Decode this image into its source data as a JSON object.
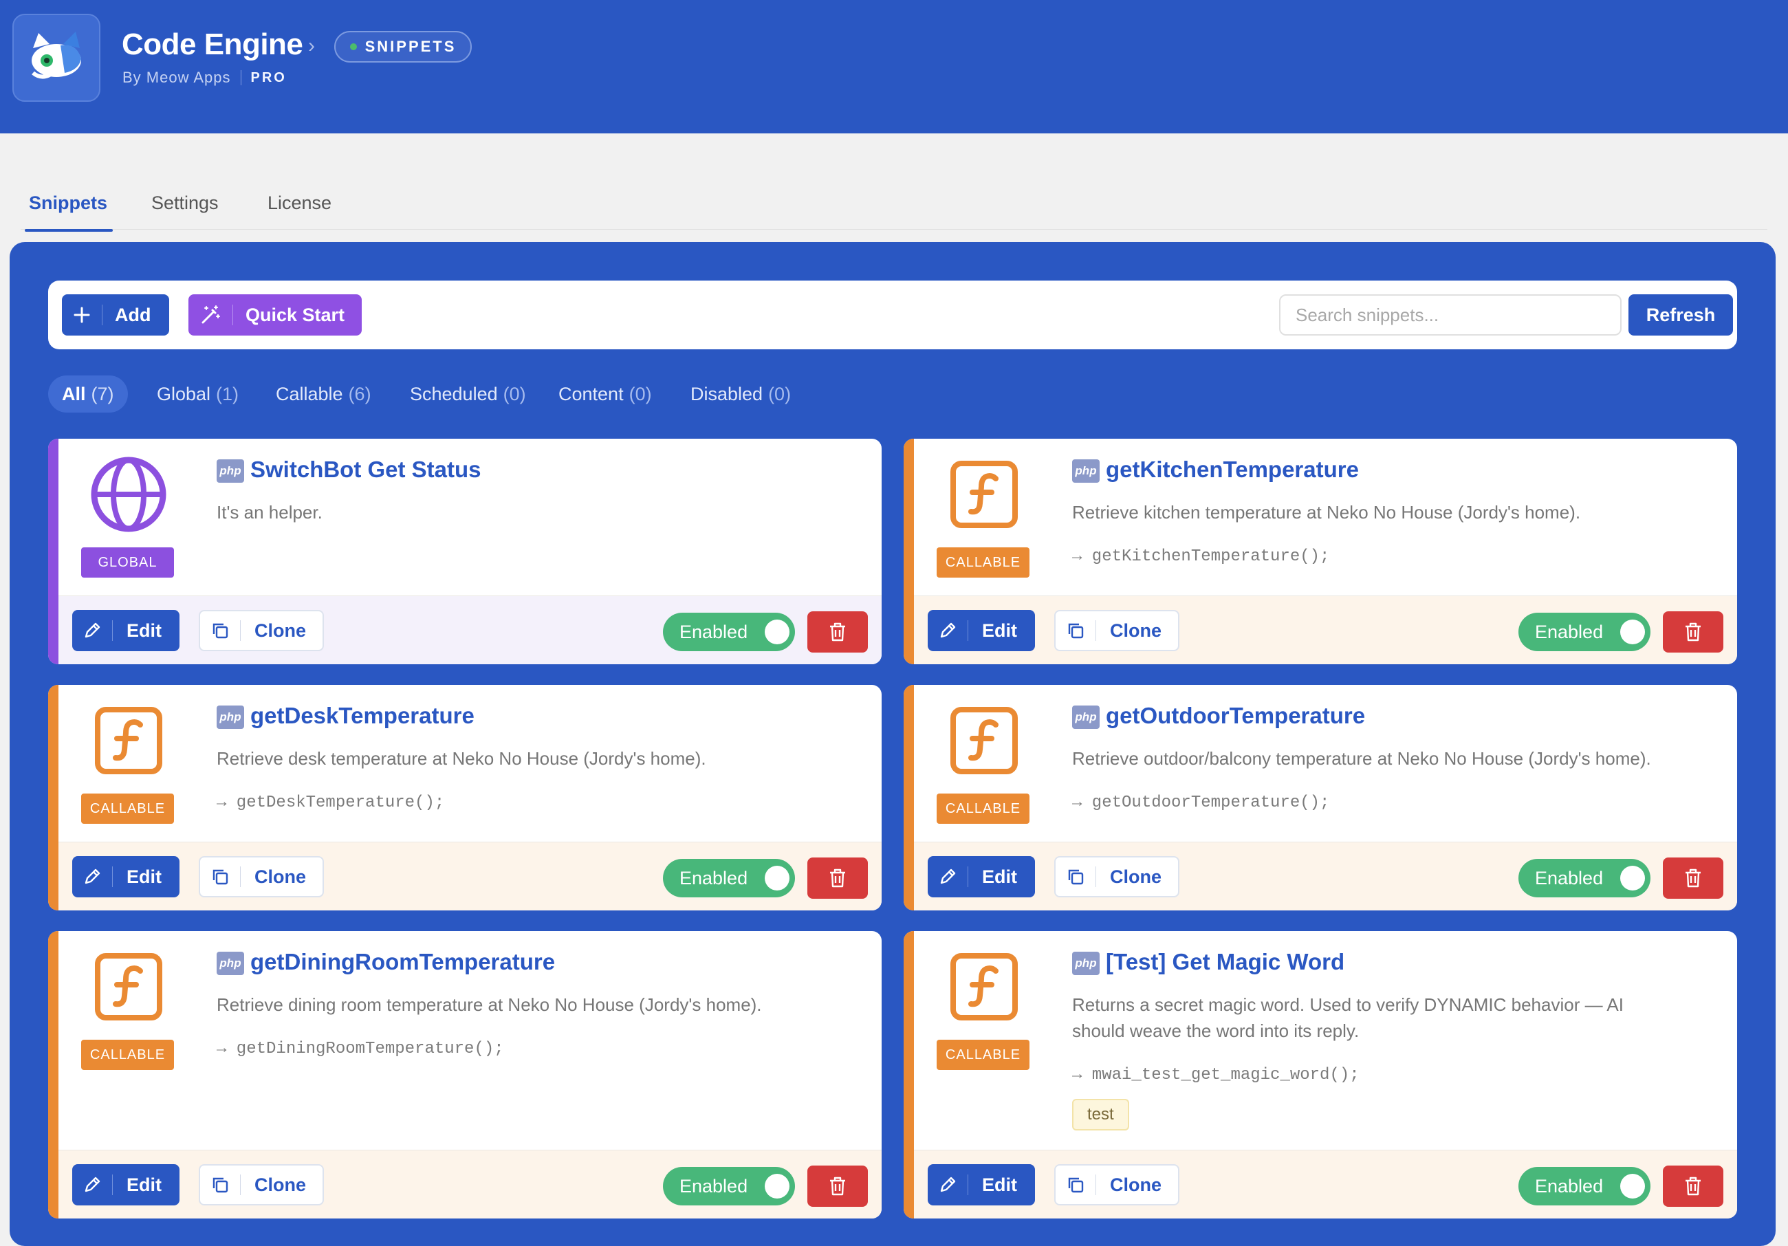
{
  "app": {
    "title": "Code Engine",
    "byline": "By Meow Apps",
    "tier": "PRO",
    "section": "SNIPPETS"
  },
  "tabs": [
    {
      "label": "Snippets",
      "active": true
    },
    {
      "label": "Settings",
      "active": false
    },
    {
      "label": "License",
      "active": false
    }
  ],
  "toolbar": {
    "add_label": "Add",
    "quick_start_label": "Quick Start",
    "search_placeholder": "Search snippets...",
    "search_value": "",
    "refresh_label": "Refresh"
  },
  "filters": [
    {
      "label": "All",
      "count": "(7)",
      "active": true
    },
    {
      "label": "Global",
      "count": "(1)",
      "active": false
    },
    {
      "label": "Callable",
      "count": "(6)",
      "active": false
    },
    {
      "label": "Scheduled",
      "count": "(0)",
      "active": false
    },
    {
      "label": "Content",
      "count": "(0)",
      "active": false
    },
    {
      "label": "Disabled",
      "count": "(0)",
      "active": false
    }
  ],
  "card_labels": {
    "lang": "php",
    "edit": "Edit",
    "clone": "Clone",
    "enabled": "Enabled"
  },
  "snippets": [
    {
      "title": "SwitchBot Get Status",
      "type": "GLOBAL",
      "icon": "globe-icon",
      "description": "It's an helper.",
      "call": "",
      "tag": "",
      "status": "Enabled"
    },
    {
      "title": "getKitchenTemperature",
      "type": "CALLABLE",
      "icon": "function-icon",
      "description": "Retrieve kitchen temperature at Neko No House (Jordy's home).",
      "call": "→ getKitchenTemperature();",
      "tag": "",
      "status": "Enabled"
    },
    {
      "title": "getDeskTemperature",
      "type": "CALLABLE",
      "icon": "function-icon",
      "description": "Retrieve desk temperature at Neko No House (Jordy's home).",
      "call": "→ getDeskTemperature();",
      "tag": "",
      "status": "Enabled"
    },
    {
      "title": "getOutdoorTemperature",
      "type": "CALLABLE",
      "icon": "function-icon",
      "description": "Retrieve outdoor/balcony temperature at Neko No House (Jordy's home).",
      "call": "→ getOutdoorTemperature();",
      "tag": "",
      "status": "Enabled"
    },
    {
      "title": "getDiningRoomTemperature",
      "type": "CALLABLE",
      "icon": "function-icon",
      "description": "Retrieve dining room temperature at Neko No House (Jordy's home).",
      "call": "→ getDiningRoomTemperature();",
      "tag": "",
      "status": "Enabled"
    },
    {
      "title": "[Test] Get Magic Word",
      "type": "CALLABLE",
      "icon": "function-icon",
      "description": "Returns a secret magic word. Used to verify DYNAMIC behavior — AI should weave the word into its reply.",
      "call": "→ mwai_test_get_magic_word();",
      "tag": "test",
      "status": "Enabled"
    }
  ],
  "colors": {
    "brand": "#2a57c2",
    "global": "#8c50df",
    "callable": "#ea8a33",
    "enabled": "#48b77a",
    "danger": "#d63b3b"
  }
}
